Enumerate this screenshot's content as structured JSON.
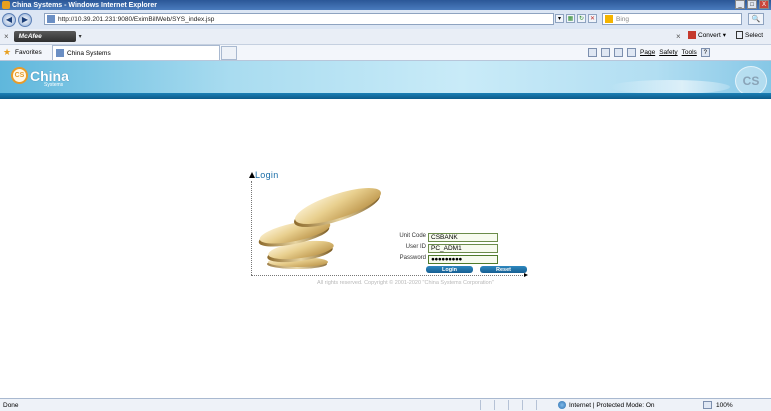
{
  "window": {
    "title": "China Systems - Windows Internet Explorer",
    "controls": [
      "_",
      "□",
      "X"
    ]
  },
  "address_bar": {
    "url": "http://10.39.201.231:9080/EximBillWeb/SYS_index.jsp",
    "dropdown": "▾",
    "refresh": "↻",
    "stop": "✕",
    "search_placeholder": "Bing",
    "search_button": "🔍"
  },
  "toolbar": {
    "close": "×",
    "mcafee_label": "McAfee",
    "mcafee_dropdown": "▾",
    "right_close": "×",
    "convert_label": "Convert",
    "convert_dropdown": "▾",
    "select_label": "Select"
  },
  "favorites_bar": {
    "favorites_label": "Favorites",
    "tab_title": "China Systems",
    "commands": [
      "Page",
      "Safety",
      "Tools"
    ],
    "help": "?"
  },
  "site_header": {
    "logo_mark": "CS",
    "logo_text": "China",
    "logo_sub": "Systems",
    "watermark": "CS"
  },
  "login": {
    "title": "Login",
    "unit_code_label": "Unit Code",
    "unit_code_value": "CSBANK",
    "user_id_label": "User ID",
    "user_id_value": "PC_ADM1",
    "password_label": "Password",
    "password_value": "●●●●●●●●●",
    "login_button": "Login",
    "reset_button": "Reset",
    "copyright": "All rights reserved. Copyright © 2001-2020 \"China Systems Corporation\""
  },
  "status_bar": {
    "status": "Done",
    "zone": "Internet | Protected Mode: On",
    "zoom": "100%"
  }
}
